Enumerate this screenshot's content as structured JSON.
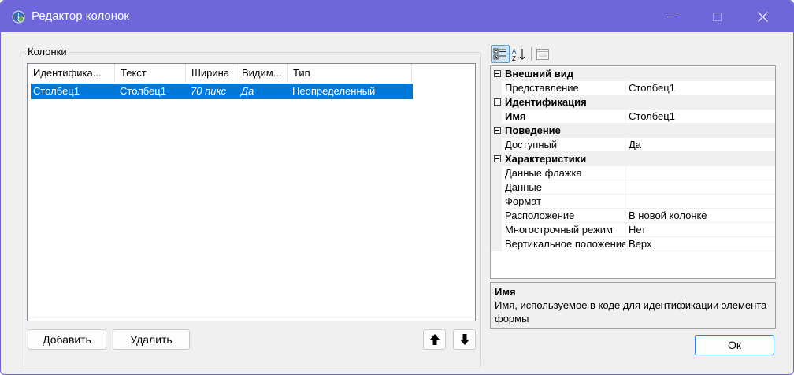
{
  "window": {
    "title": "Редактор колонок",
    "icon": "gear-globe-icon",
    "accent": "#6f67d9"
  },
  "columns_group": {
    "label": "Колонки",
    "headers": [
      "Идентифика...",
      "Текст",
      "Ширина",
      "Видим...",
      "Тип"
    ],
    "rows": [
      {
        "id": "Столбец1",
        "text": "Столбец1",
        "width": "70 пикс",
        "visible": "Да",
        "type": "Неопределенный"
      }
    ],
    "selection_color": "#0078d7"
  },
  "buttons": {
    "add": "Добавить",
    "delete": "Удалить",
    "up_icon": "arrow-up-icon",
    "down_icon": "arrow-down-icon",
    "ok": "Ок"
  },
  "property_grid": {
    "toolbar": {
      "categorized_icon": "categorized-icon",
      "alphabetical_icon": "sort-az-icon",
      "pages_icon": "property-pages-icon"
    },
    "categories": [
      {
        "name": "Внешний вид",
        "properties": [
          {
            "name": "Представление",
            "value": "Столбец1",
            "bold": false
          }
        ]
      },
      {
        "name": "Идентификация",
        "properties": [
          {
            "name": "Имя",
            "value": "Столбец1",
            "bold": true
          }
        ]
      },
      {
        "name": "Поведение",
        "properties": [
          {
            "name": "Доступный",
            "value": "Да",
            "bold": false
          }
        ]
      },
      {
        "name": "Характеристики",
        "properties": [
          {
            "name": "Данные флажка",
            "value": "",
            "bold": false
          },
          {
            "name": "Данные",
            "value": "",
            "bold": false
          },
          {
            "name": "Формат",
            "value": "",
            "bold": false
          },
          {
            "name": "Расположение",
            "value": "В новой колонке",
            "bold": false
          },
          {
            "name": "Многострочный режим",
            "value": "Нет",
            "bold": false
          },
          {
            "name": "Вертикальное положение",
            "value": "Верх",
            "bold": false
          }
        ]
      }
    ]
  },
  "help": {
    "title": "Имя",
    "description": "Имя, используемое в коде для идентификации элемента формы"
  }
}
